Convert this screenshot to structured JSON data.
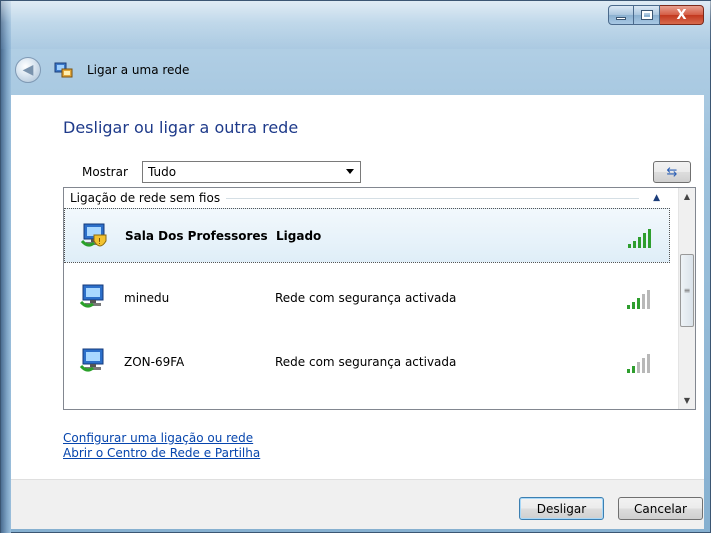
{
  "window": {
    "title": "Ligar a uma rede",
    "controls": {
      "minimize": "",
      "maximize": "",
      "close": "X"
    }
  },
  "main": {
    "heading": "Desligar ou ligar a outra rede",
    "filter": {
      "label": "Mostrar",
      "value": "Tudo"
    },
    "group_header": "Ligação de rede sem fios",
    "networks": [
      {
        "name": "Sala Dos Professores",
        "status": "Ligado",
        "selected": true,
        "signal_bars": 5
      },
      {
        "name": "minedu",
        "status": "Rede com segurança activada",
        "selected": false,
        "signal_bars": 3
      },
      {
        "name": "ZON-69FA",
        "status": "Rede com segurança activada",
        "selected": false,
        "signal_bars": 2
      }
    ],
    "links": [
      "Configurar uma ligação ou rede",
      "Abrir o Centro de Rede e Partilha"
    ]
  },
  "footer": {
    "disconnect_label": "Desligar",
    "cancel_label": "Cancelar"
  },
  "colors": {
    "heading": "#1e3a8a",
    "link": "#0645ad",
    "signal_active": "#2e9e2e",
    "signal_inactive": "#b8b8b8"
  }
}
